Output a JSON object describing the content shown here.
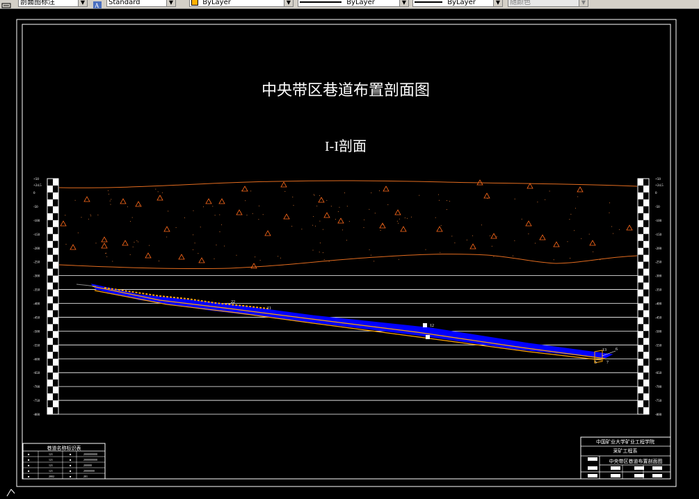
{
  "toolbar": {
    "dimstyle_value": "剖面图标注",
    "textstyle_value": "Standard",
    "layer_value": "ByLayer",
    "linetype_value": "ByLayer",
    "lineweight_value": "ByLayer",
    "plotstyle_value": "随颜色",
    "layer_color": "#ffb000"
  },
  "drawing": {
    "title": "中央带区巷道布置剖面图",
    "subtitle": "I-I剖面",
    "colors": {
      "terrain": "#e36c1f",
      "gravel": "#ff6a1a",
      "seam": "#0000ff",
      "roadway": "#ffa500",
      "grid": "#ffffff"
    },
    "depth_labels": [
      "+50",
      "+24.5",
      "0",
      "-50",
      "-100",
      "-150",
      "-200",
      "-250",
      "-300",
      "-350",
      "-400",
      "-450",
      "-500",
      "-550",
      "-600",
      "-650",
      "-700",
      "-750",
      "-800"
    ],
    "roadway_labels": [
      "22",
      "11",
      "12",
      "13",
      "6",
      "5",
      "7"
    ],
    "legend": {
      "title": "巷道名称标识表",
      "rows": [
        [
          "■",
          "121",
          "■",
          "2000000000"
        ],
        [
          "■",
          "121",
          "■",
          "2000000000"
        ],
        [
          "■",
          "121",
          "■",
          "200000"
        ],
        [
          "■",
          "121",
          "■",
          "20000000"
        ],
        [
          "■",
          "2002",
          "■",
          "201"
        ]
      ]
    },
    "title_block": {
      "school": "中国矿业大学矿业工程学院",
      "dept": "采矿工程系",
      "drawing_name": "中央带区巷道布置剖面图"
    }
  }
}
